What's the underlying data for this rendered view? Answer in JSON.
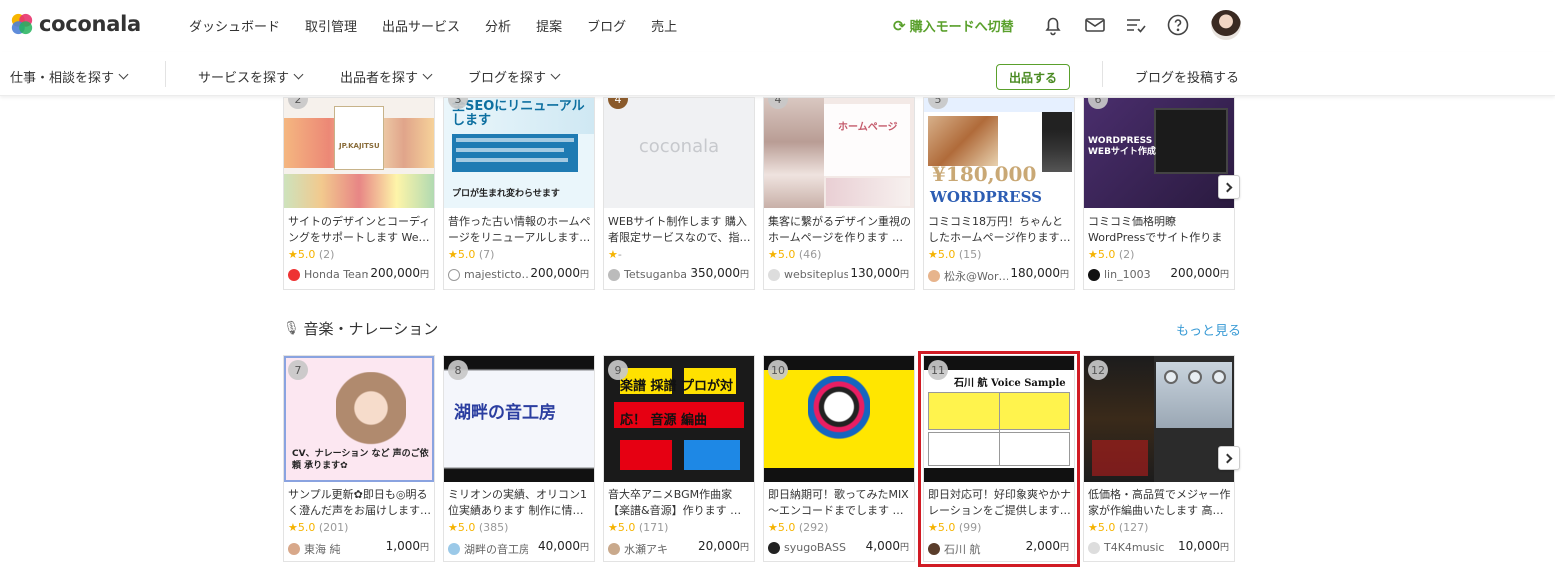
{
  "header": {
    "brand": "coconala",
    "nav": [
      "ダッシュボード",
      "取引管理",
      "出品サービス",
      "分析",
      "提案",
      "ブログ",
      "売上"
    ],
    "mode_switch": "購入モードへ切替",
    "icons": [
      "bell-icon",
      "mail-icon",
      "checklist-icon",
      "help-icon"
    ]
  },
  "subnav": {
    "left_item": "仕事・相談を探す",
    "items": [
      "サービスを探す",
      "出品者を探す",
      "ブログを探す"
    ],
    "sell_button": "出品する",
    "post_blog": "ブログを投稿する"
  },
  "row1": {
    "cards": [
      {
        "rank": "2",
        "title": "サイトのデザインとコーディングをサポートします We…",
        "rating": "5.0",
        "reviews": "(2)",
        "seller": "Honda Team",
        "price": "200,000",
        "yen": "円",
        "thumb_text": "JP.KAJITSU"
      },
      {
        "rank": "3",
        "title": "昔作った古い情報のホームページをリニューアルします…",
        "rating": "5.0",
        "reviews": "(7)",
        "seller": "majesticto…",
        "price": "200,000",
        "yen": "円",
        "thumb_text": "全SEOにリニューアルします",
        "thumb_sub": "プロが生まれ変わらせます"
      },
      {
        "rank": "4",
        "title": "WEBサイト制作します 購入者限定サービスなので、指…",
        "rating": "",
        "reviews": "-",
        "seller": "Tetsuganba",
        "price": "350,000",
        "yen": "円",
        "thumb_text": "coconala"
      },
      {
        "rank": "4",
        "title": "集客に繋がるデザイン重視のホームページを作ります …",
        "rating": "5.0",
        "reviews": "(46)",
        "seller": "websiteplus",
        "price": "130,000",
        "yen": "円",
        "thumb_text": "ホームページ"
      },
      {
        "rank": "5",
        "title": "コミコミ18万円！ちゃんとしたホームページ作ります…",
        "rating": "5.0",
        "reviews": "(15)",
        "seller": "松永@Wor…",
        "price": "180,000",
        "yen": "円",
        "thumb_text": "¥180,000",
        "thumb_sub": "WORDPRESS"
      },
      {
        "rank": "6",
        "title": "コミコミ価格明瞭WordPressでサイト作ります 詳しく…",
        "rating": "5.0",
        "reviews": "(2)",
        "seller": "lin_1003",
        "price": "200,000",
        "yen": "円",
        "thumb_text": "WORDPRESS WEBサイト作成"
      }
    ]
  },
  "section": {
    "title": "音楽・ナレーション",
    "more": "もっと見る"
  },
  "row2": {
    "cards": [
      {
        "rank": "7",
        "title": "サンプル更新✿即日も◎明るく澄んだ声をお届けします…",
        "rating": "5.0",
        "reviews": "(201)",
        "seller": "東海 純",
        "price": "1,000",
        "yen": "円",
        "thumb_text": "CV、ナレーション など 声のご依頼 承ります✿"
      },
      {
        "rank": "8",
        "title": "ミリオンの実績、オリコン1位実績あります 制作に情…",
        "rating": "5.0",
        "reviews": "(385)",
        "seller": "湖畔の音工房",
        "price": "40,000",
        "yen": "円",
        "thumb_text": "湖畔の音工房"
      },
      {
        "rank": "9",
        "title": "音大卒アニメBGM作曲家【楽譜&音源】作ります …",
        "rating": "5.0",
        "reviews": "(171)",
        "seller": "水瀬アキ",
        "price": "20,000",
        "yen": "円",
        "thumb_text": "楽譜 採譜 プロが対応！ 音源 編曲"
      },
      {
        "rank": "10",
        "title": "即日納期可！歌ってみたMIX～エンコードまでします …",
        "rating": "5.0",
        "reviews": "(292)",
        "seller": "syugoBASS",
        "price": "4,000",
        "yen": "円",
        "thumb_text": ""
      },
      {
        "rank": "11",
        "title": "即日対応可！好印象爽やかナレーションをご提供します…",
        "rating": "5.0",
        "reviews": "(99)",
        "seller": "石川 航",
        "price": "2,000",
        "yen": "円",
        "thumb_text": "石川 航 Voice Sample"
      },
      {
        "rank": "12",
        "title": "低価格・高品質でメジャー作家が作編曲いたします 高…",
        "rating": "5.0",
        "reviews": "(127)",
        "seller": "T4K4music",
        "price": "10,000",
        "yen": "円",
        "thumb_text": ""
      }
    ]
  },
  "colors": {
    "accent_green": "#5aa02c",
    "link_blue": "#3a9bd5",
    "star": "#f5b301",
    "highlight_red": "#d11b24"
  }
}
